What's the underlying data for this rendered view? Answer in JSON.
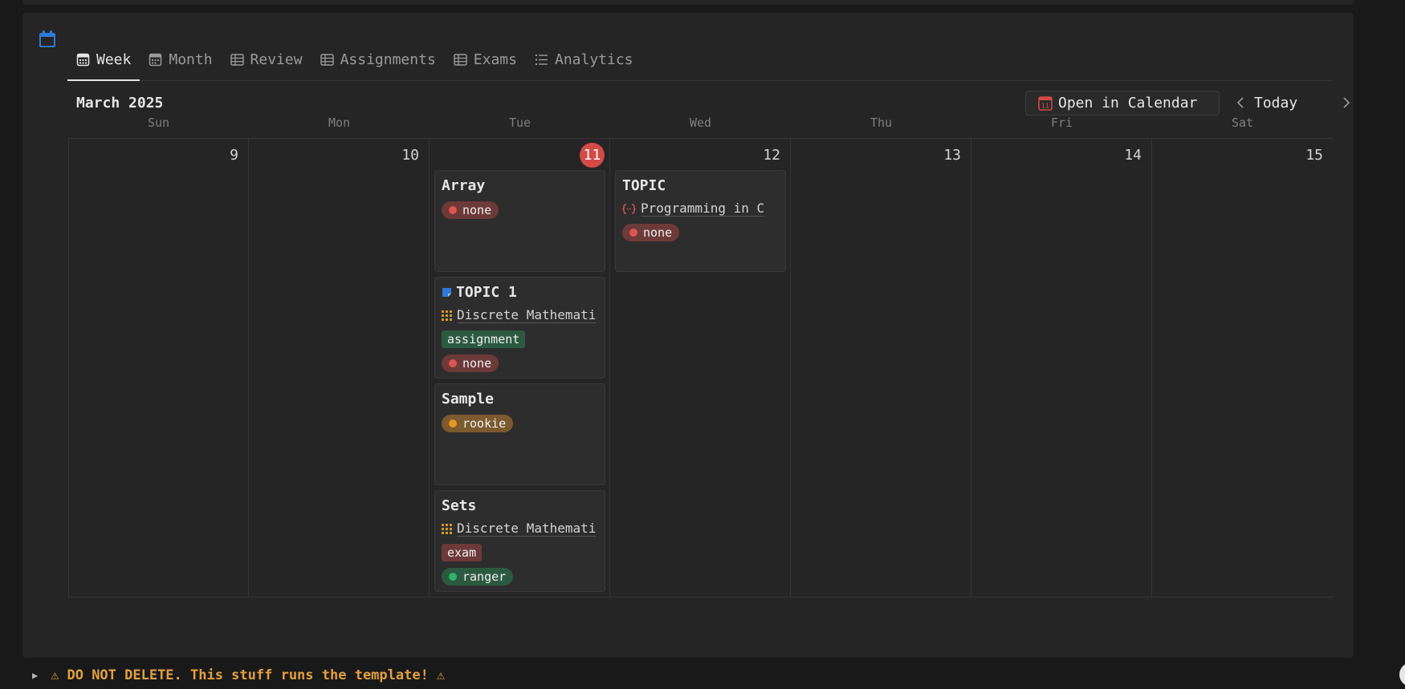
{
  "tabs": [
    {
      "label": "Week",
      "icon": "calendar-week-icon",
      "active": true
    },
    {
      "label": "Month",
      "icon": "calendar-month-icon",
      "active": false
    },
    {
      "label": "Review",
      "icon": "table-icon",
      "active": false
    },
    {
      "label": "Assignments",
      "icon": "table-icon",
      "active": false
    },
    {
      "label": "Exams",
      "icon": "table-icon",
      "active": false
    },
    {
      "label": "Analytics",
      "icon": "list-icon",
      "active": false
    }
  ],
  "calendar": {
    "month_title": "March 2025",
    "open_button": "Open in Calendar",
    "open_button_icon_day": "11",
    "today_button": "Today",
    "weekdays": [
      "Sun",
      "Mon",
      "Tue",
      "Wed",
      "Thu",
      "Fri",
      "Sat"
    ],
    "days": [
      "9",
      "10",
      "11",
      "12",
      "13",
      "14",
      "15"
    ],
    "today_index": 2
  },
  "events": {
    "tue": [
      {
        "title": "Array",
        "status": "none"
      },
      {
        "title": "TOPIC 1",
        "relation": "Discrete Mathemati",
        "tag": "assignment",
        "status": "none"
      },
      {
        "title": "Sample",
        "status": "rookie"
      },
      {
        "title": "Sets",
        "relation": "Discrete Mathemati",
        "tag": "exam",
        "status": "ranger"
      }
    ],
    "wed": [
      {
        "title": "TOPIC",
        "relation": "Programming in C",
        "status": "none"
      }
    ]
  },
  "footer": {
    "warning": "DO NOT DELETE. This stuff runs the template!",
    "warning_icon": "⚠"
  },
  "colors": {
    "accent_blue": "#2f7ad6",
    "today_red": "#d34a47",
    "warning_orange": "#e3a03f"
  }
}
